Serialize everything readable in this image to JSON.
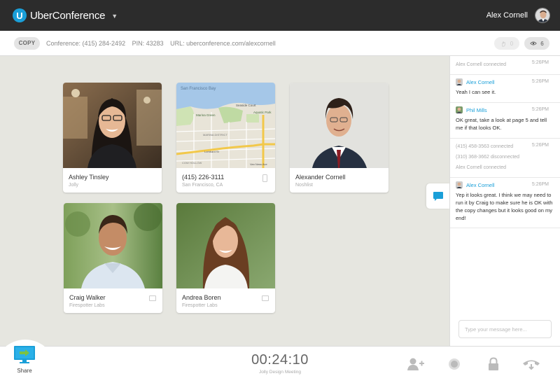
{
  "app": {
    "logo_letter": "U",
    "name": "UberConference",
    "menu_caret": "▼"
  },
  "user": {
    "name": "Alex Cornell"
  },
  "conference": {
    "copy_label": "COPY",
    "number": "Conference: (415) 284-2492",
    "pin": "PIN: 43283",
    "url": "URL: uberconference.com/alexcornell",
    "raised_hands": "0",
    "viewers": "6"
  },
  "participants": [
    {
      "name": "Ashley Tinsley",
      "company": "Jolly",
      "device": "none",
      "photo": "woman-dark-hair"
    },
    {
      "name": "(415) 226-3111",
      "company": "San Francisco, CA",
      "device": "phone",
      "photo": "map"
    },
    {
      "name": "Alexander Cornell",
      "company": "Noshlist",
      "device": "none",
      "photo": "man-suit"
    },
    {
      "name": "Craig Walker",
      "company": "Firespotter Labs",
      "device": "computer",
      "photo": "man-outdoors"
    },
    {
      "name": "Andrea Boren",
      "company": "Firespotter Labs",
      "device": "computer",
      "photo": "woman-brown-hair"
    }
  ],
  "map_labels": {
    "bay": "San Francisco Bay",
    "marina_green": "Marina Green",
    "seaside": "Seaside Court",
    "aquatic_park": "Aquatic Park",
    "marina_district": "MARINA DISTRICT",
    "lombard": "Lombard St",
    "cow_hollow": "COW HOLLOW",
    "van_ness": "Van Ness Ave"
  },
  "chat": {
    "events": [
      {
        "type": "system",
        "lines": [
          "Alex Cornell connected"
        ],
        "time": "5:26PM"
      },
      {
        "type": "message",
        "author": "Alex Cornell",
        "time": "5:26PM",
        "text": "Yeah I can see it."
      },
      {
        "type": "message",
        "author": "Phil Mills",
        "time": "5:26PM",
        "text": "OK great, take a look at page 5 and tell me if that looks OK."
      },
      {
        "type": "system",
        "lines": [
          "(415) 458-3563 connected",
          "(310) 368-3662 disconnected",
          "Alex Cornell connected"
        ],
        "time": "5:26PM"
      },
      {
        "type": "message",
        "author": "Alex Cornell",
        "time": "5:26PM",
        "text": "Yep it looks great. I think we may need to run it by Craig to make sure he is OK with the copy changes but it looks good on my end!"
      }
    ],
    "input_placeholder": "Type your message here..."
  },
  "footer": {
    "share_label": "Share",
    "timer": "00:24:10",
    "meeting_name": "Jolly Design Meeting"
  },
  "icons": {
    "add_participant": "add-person-icon",
    "record": "record-icon",
    "lock": "lock-icon",
    "hangup": "hangup-icon",
    "share": "screen-share-icon",
    "chat": "chat-bubble-icon"
  },
  "colors": {
    "accent": "#1a9fd8",
    "topbar": "#2c2c2c",
    "stage": "#e6e6e0"
  }
}
